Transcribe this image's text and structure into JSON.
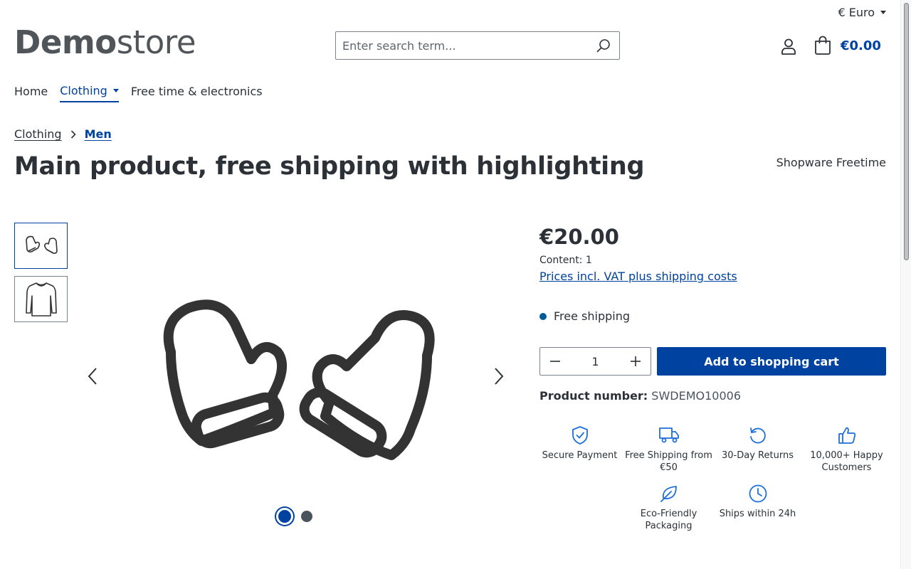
{
  "header": {
    "currency": "€ Euro",
    "logo_bold": "Demo",
    "logo_light": "store",
    "search_placeholder": "Enter search term...",
    "cart_total": "€0.00"
  },
  "nav": {
    "items": [
      {
        "label": "Home"
      },
      {
        "label": "Clothing"
      },
      {
        "label": "Free time & electronics"
      }
    ]
  },
  "breadcrumb": {
    "items": [
      {
        "label": "Clothing"
      },
      {
        "label": "Men"
      }
    ]
  },
  "product": {
    "title": "Main product, free shipping with highlighting",
    "manufacturer": "Shopware Freetime",
    "price": "€20.00",
    "content": "Content: 1",
    "vat_link": "Prices incl. VAT plus shipping costs",
    "shipping": "Free shipping",
    "quantity": "1",
    "add_to_cart": "Add to shopping cart",
    "product_number_label": "Product number:",
    "product_number": "SWDEMO10006"
  },
  "gallery": {
    "image_count": 2,
    "active_index": 1
  },
  "features": [
    {
      "label": "Secure Payment",
      "icon": "shield-check-icon"
    },
    {
      "label": "Free Shipping from €50",
      "icon": "truck-icon"
    },
    {
      "label": "30-Day Returns",
      "icon": "return-arrow-icon"
    },
    {
      "label": "10,000+ Happy Customers",
      "icon": "thumbs-up-icon"
    },
    {
      "label": "Eco-Friendly Packaging",
      "icon": "leaf-icon"
    },
    {
      "label": "Ships within 24h",
      "icon": "clock-icon"
    }
  ],
  "colors": {
    "accent": "#0042a0",
    "text": "#2b3136",
    "feature_icon": "#1e6fd9"
  }
}
